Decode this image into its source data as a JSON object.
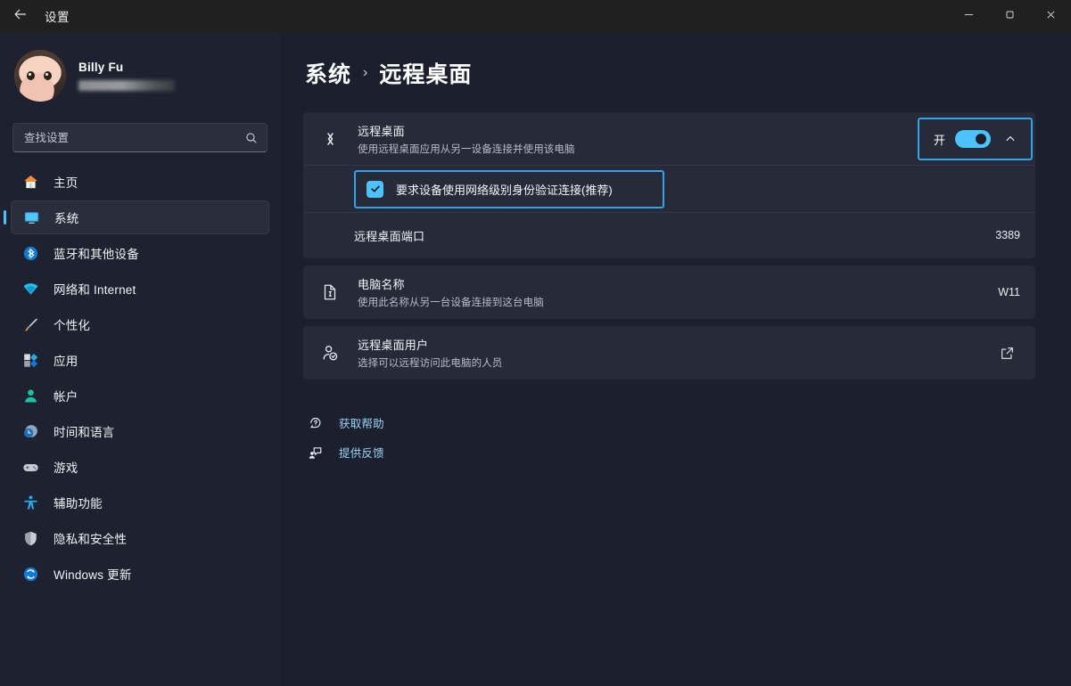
{
  "window": {
    "title": "设置",
    "back_icon": "back-arrow-icon",
    "minimize_label": "最小化",
    "maximize_label": "最大化",
    "close_label": "关闭"
  },
  "accent": "#4cc2ff",
  "highlight_color": "#36a3e8",
  "sidebar": {
    "profile": {
      "name": "Billy Fu",
      "email_redacted": ""
    },
    "search": {
      "placeholder": "查找设置",
      "value": "",
      "icon": "search-icon"
    },
    "items": [
      {
        "label": "主页",
        "icon": "home-icon",
        "selected": false
      },
      {
        "label": "系统",
        "icon": "system-monitor-icon",
        "selected": true
      },
      {
        "label": "蓝牙和其他设备",
        "icon": "bluetooth-icon",
        "selected": false
      },
      {
        "label": "网络和 Internet",
        "icon": "wifi-icon",
        "selected": false
      },
      {
        "label": "个性化",
        "icon": "paintbrush-icon",
        "selected": false
      },
      {
        "label": "应用",
        "icon": "apps-icon",
        "selected": false
      },
      {
        "label": "帐户",
        "icon": "account-person-icon",
        "selected": false
      },
      {
        "label": "时间和语言",
        "icon": "clock-globe-icon",
        "selected": false
      },
      {
        "label": "游戏",
        "icon": "gamepad-icon",
        "selected": false
      },
      {
        "label": "辅助功能",
        "icon": "accessibility-icon",
        "selected": false
      },
      {
        "label": "隐私和安全性",
        "icon": "shield-icon",
        "selected": false
      },
      {
        "label": "Windows 更新",
        "icon": "update-refresh-icon",
        "selected": false
      }
    ]
  },
  "breadcrumb": {
    "parent": "系统",
    "separator": "›",
    "current": "远程桌面"
  },
  "main": {
    "remote_desktop": {
      "icon": "remote-desktop-icon",
      "title": "远程桌面",
      "subtitle": "使用远程桌面应用从另一设备连接并使用该电脑",
      "toggle_state_label": "开",
      "toggle_on": true,
      "expander_icon": "chevron-up-icon"
    },
    "nla_checkbox": {
      "label": "要求设备使用网络级别身份验证连接(推荐)",
      "checked": true
    },
    "port": {
      "title": "远程桌面端口",
      "value": "3389"
    },
    "computer_name": {
      "icon": "rename-document-icon",
      "title": "电脑名称",
      "subtitle": "使用此名称从另一台设备连接到这台电脑",
      "value": "W11"
    },
    "remote_users": {
      "icon": "user-check-icon",
      "title": "远程桌面用户",
      "subtitle": "选择可以远程访问此电脑的人员",
      "action_icon": "external-link-icon"
    },
    "links": [
      {
        "label": "获取帮助",
        "icon": "help-icon"
      },
      {
        "label": "提供反馈",
        "icon": "feedback-icon"
      }
    ]
  }
}
